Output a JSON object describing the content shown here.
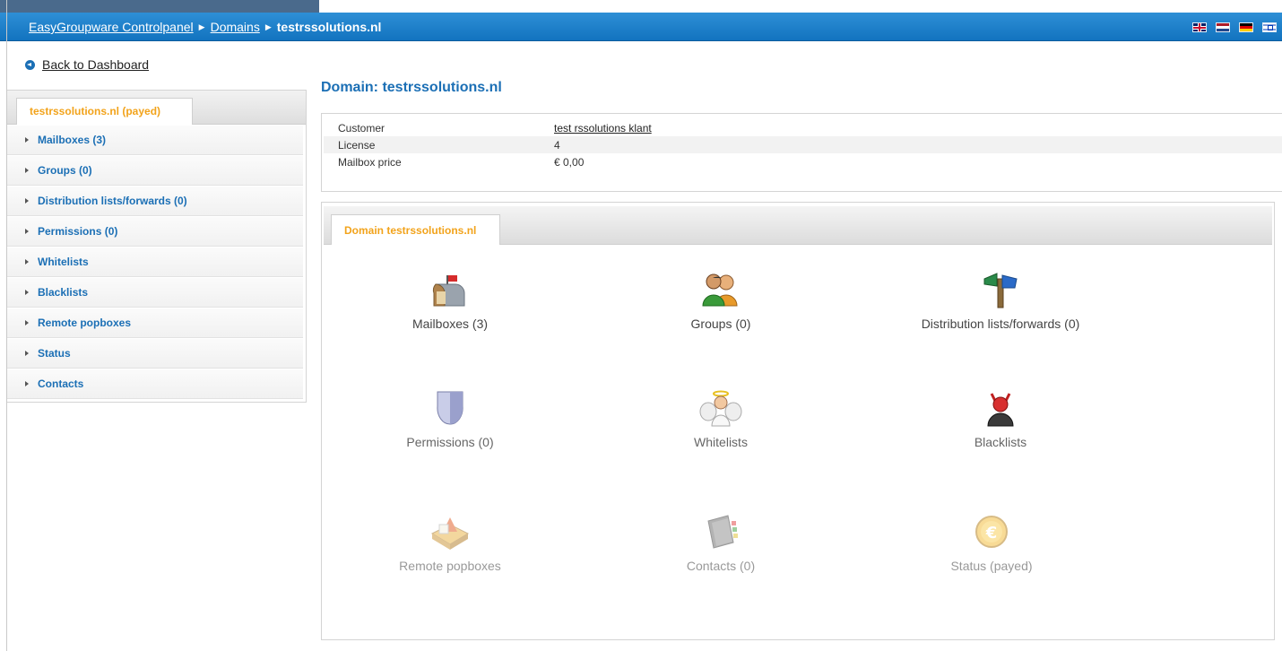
{
  "breadcrumb": {
    "root": "EasyGroupware Controlpanel",
    "domains": "Domains",
    "current": "testrssolutions.nl"
  },
  "flags": [
    "uk-flag-icon",
    "nl-flag-icon",
    "de-flag-icon",
    "il-flag-icon"
  ],
  "back_link": "Back to Dashboard",
  "sidebar": {
    "tab": "testrssolutions.nl (payed)",
    "items": [
      {
        "label": "Mailboxes (3)"
      },
      {
        "label": "Groups (0)"
      },
      {
        "label": "Distribution lists/forwards (0)"
      },
      {
        "label": "Permissions (0)"
      },
      {
        "label": "Whitelists"
      },
      {
        "label": "Blacklists"
      },
      {
        "label": "Remote popboxes"
      },
      {
        "label": "Status"
      },
      {
        "label": "Contacts"
      }
    ]
  },
  "main": {
    "title": "Domain: testrssolutions.nl",
    "info": [
      {
        "key": "Customer",
        "value": "test rssolutions klant"
      },
      {
        "key": "License",
        "value": "4"
      },
      {
        "key": "Mailbox price",
        "value": "€ 0,00"
      }
    ],
    "panel_tab": "Domain testrssolutions.nl",
    "tiles": [
      {
        "label": "Mailboxes (3)",
        "icon": "mailbox-icon"
      },
      {
        "label": "Groups (0)",
        "icon": "users-icon"
      },
      {
        "label": "Distribution lists/forwards (0)",
        "icon": "signpost-icon"
      },
      {
        "label": "Permissions (0)",
        "icon": "shield-icon"
      },
      {
        "label": "Whitelists",
        "icon": "angel-icon"
      },
      {
        "label": "Blacklists",
        "icon": "devil-icon"
      },
      {
        "label": "Remote popboxes",
        "icon": "inbox-tray-icon"
      },
      {
        "label": "Contacts (0)",
        "icon": "address-book-icon"
      },
      {
        "label": "Status (payed)",
        "icon": "euro-coin-icon"
      }
    ]
  },
  "colors": {
    "header_blue": "#1b7fcb",
    "link_blue": "#1b6fb5",
    "tab_orange": "#f2a31b"
  }
}
